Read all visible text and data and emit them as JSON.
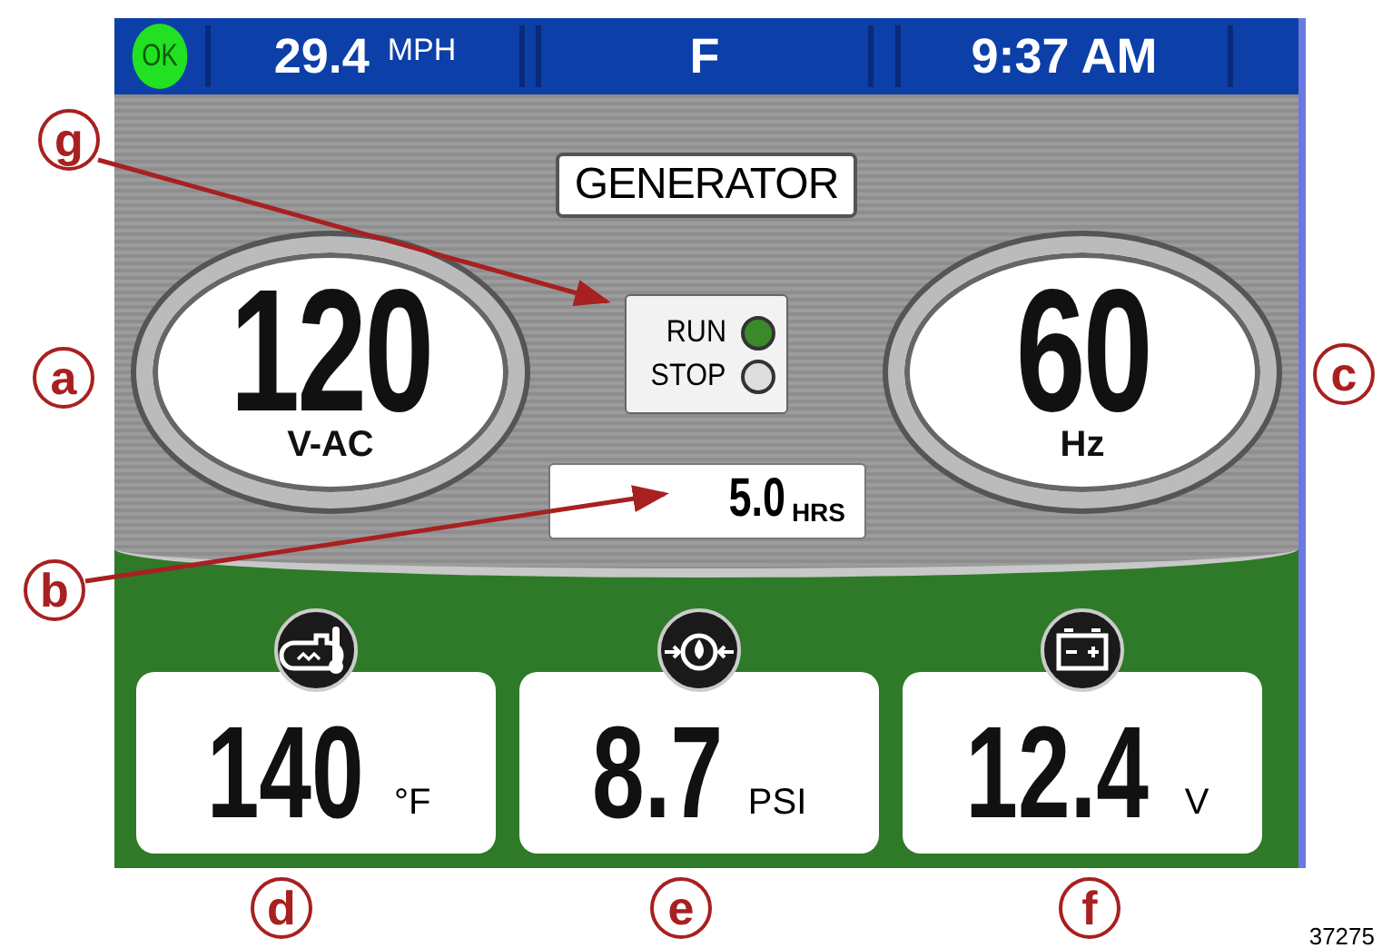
{
  "status_bar": {
    "ok_badge": "OK",
    "speed": "29.4",
    "speed_unit": "MPH",
    "center_field": "F",
    "clock": "9:37 AM"
  },
  "panel": {
    "title": "GENERATOR",
    "voltage": {
      "value": "120",
      "unit": "V-AC"
    },
    "frequency": {
      "value": "60",
      "unit": "Hz"
    },
    "status": [
      {
        "label": "RUN",
        "on": true
      },
      {
        "label": "STOP",
        "on": false
      }
    ],
    "hours": {
      "value": "5.0",
      "unit": "HRS"
    }
  },
  "gauges": [
    {
      "kind": "temperature",
      "value": "140",
      "unit": "°F"
    },
    {
      "kind": "pressure",
      "value": "8.7",
      "unit": "PSI"
    },
    {
      "kind": "battery",
      "value": "12.4",
      "unit": "V"
    }
  ],
  "callouts": [
    {
      "label": "a"
    },
    {
      "label": "b"
    },
    {
      "label": "c"
    },
    {
      "label": "d"
    },
    {
      "label": "e"
    },
    {
      "label": "f"
    },
    {
      "label": "g"
    }
  ],
  "figure_number": "37275"
}
